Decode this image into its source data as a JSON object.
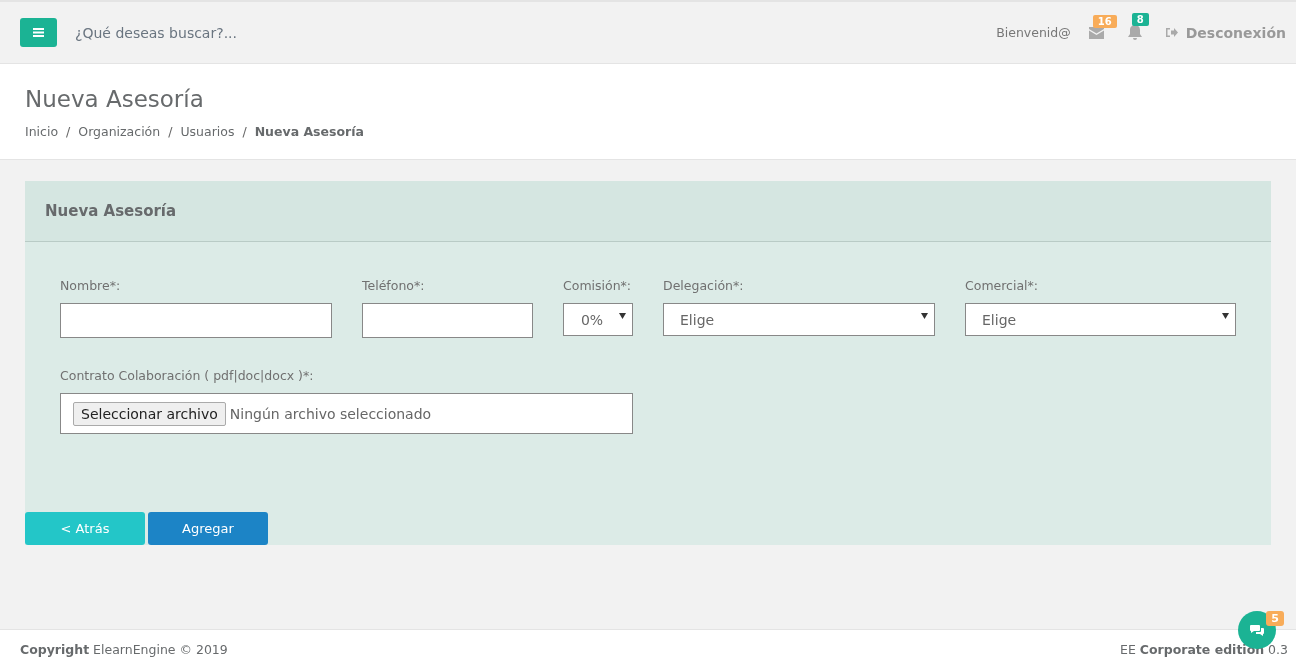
{
  "topbar": {
    "search_placeholder": "¿Qué deseas buscar?...",
    "welcome": "Bienvenid@",
    "messages_badge": "16",
    "notifications_badge": "8",
    "logout": "Desconexión"
  },
  "page": {
    "title": "Nueva Asesoría",
    "breadcrumb": [
      {
        "label": "Inicio",
        "selected": false
      },
      {
        "label": "Organización",
        "selected": false
      },
      {
        "label": "Usuarios",
        "selected": false
      },
      {
        "label": "Nueva Asesoría",
        "selected": true
      }
    ],
    "separator": "/"
  },
  "panel": {
    "title": "Nueva Asesoría",
    "fields": [
      {
        "kind": "text",
        "label": "Nombre*:"
      },
      {
        "kind": "text",
        "label": "Teléfono*:"
      },
      {
        "kind": "select",
        "label": "Comisión*:",
        "value": "0%"
      },
      {
        "kind": "select",
        "label": "Delegación*:",
        "value": "Elige"
      },
      {
        "kind": "select",
        "label": "Comercial*:",
        "value": "Elige"
      }
    ],
    "file_field": {
      "label": "Contrato Colaboración ( pdf|doc|docx )*:",
      "button": "Seleccionar archivo",
      "status": "Ningún archivo seleccionado"
    },
    "buttons": [
      {
        "kind": "back",
        "label": "< Atrás"
      },
      {
        "kind": "primary",
        "label": "Agregar"
      }
    ]
  },
  "footer": {
    "left": "**Copyright** ElearnEngine © 2019",
    "right": "EE **Corporate edition** 0.3"
  },
  "chat": {
    "badge": "5"
  }
}
